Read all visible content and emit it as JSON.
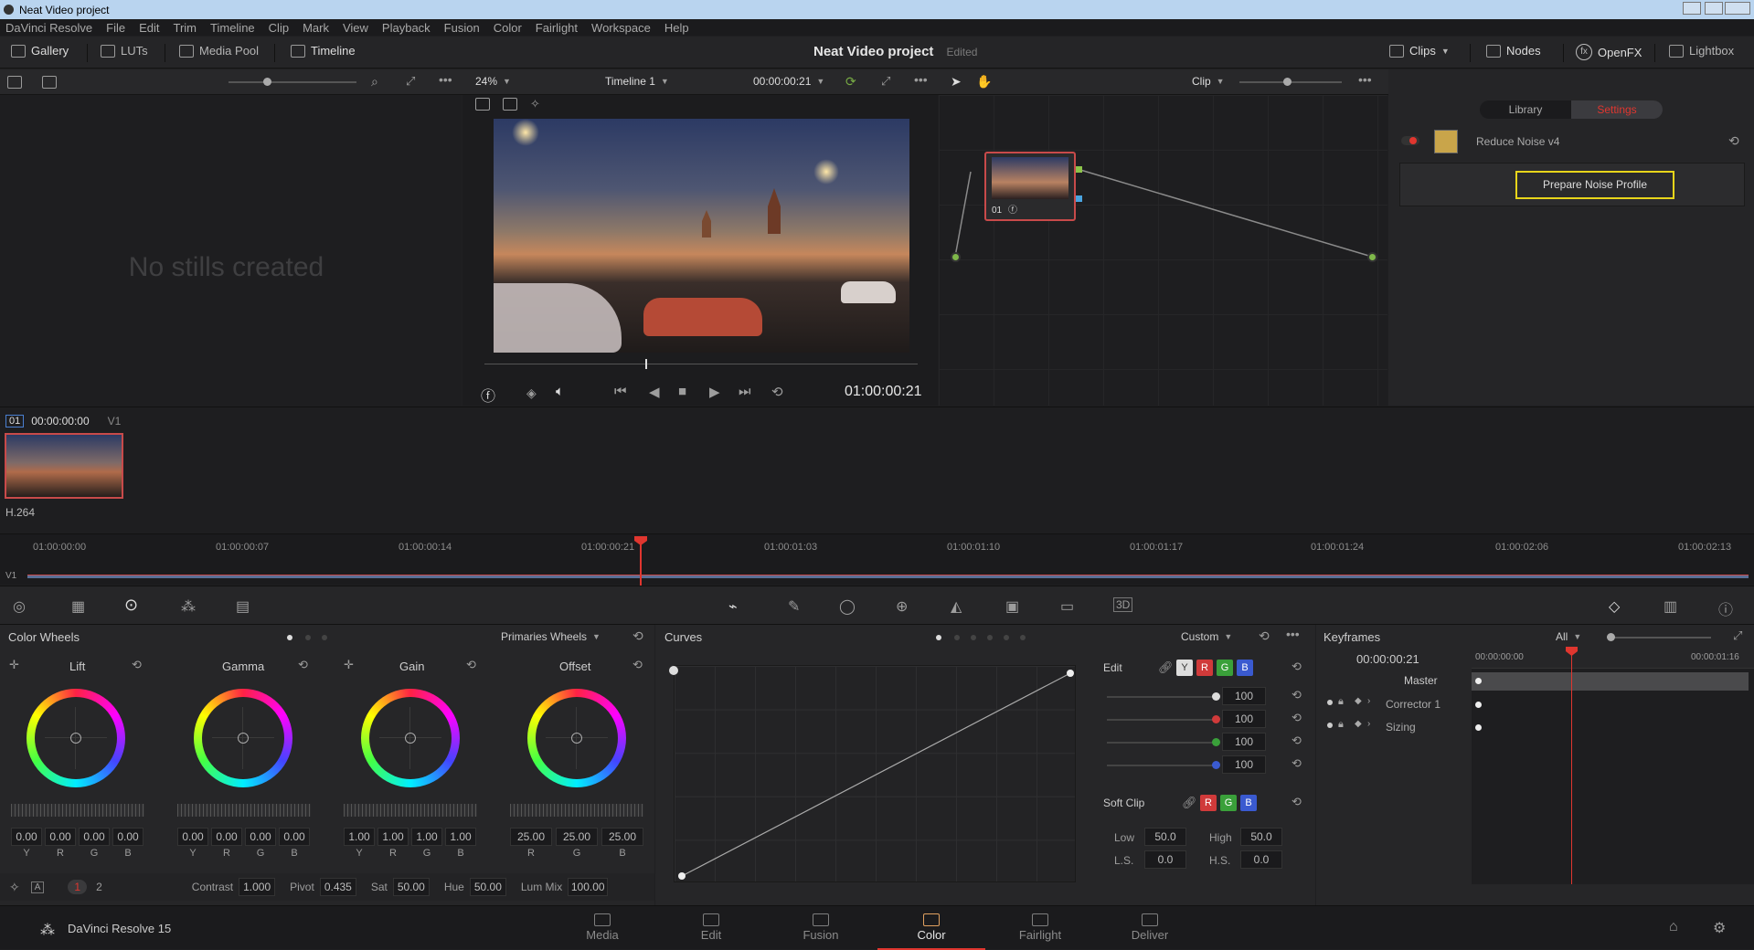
{
  "window": {
    "title": "Neat Video project"
  },
  "menu": [
    "DaVinci Resolve",
    "File",
    "Edit",
    "Trim",
    "Timeline",
    "Clip",
    "Mark",
    "View",
    "Playback",
    "Fusion",
    "Color",
    "Fairlight",
    "Workspace",
    "Help"
  ],
  "toolbar": {
    "gallery": "Gallery",
    "luts": "LUTs",
    "media_pool": "Media Pool",
    "timeline": "Timeline",
    "project_name": "Neat Video project",
    "project_status": "Edited",
    "clips": "Clips",
    "nodes": "Nodes",
    "openfx": "OpenFX",
    "lightbox": "Lightbox"
  },
  "viewer": {
    "zoom": "24%",
    "timeline_name": "Timeline 1",
    "timecode_top": "00:00:00:21",
    "timecode": "01:00:00:21"
  },
  "gallery": {
    "empty_text": "No stills created"
  },
  "nodes_panel": {
    "mode": "Clip",
    "node_label": "01"
  },
  "fx": {
    "tabs": [
      "Library",
      "Settings"
    ],
    "active_tab": "Settings",
    "effect_name": "Reduce Noise v4",
    "prepare_button": "Prepare Noise Profile"
  },
  "clip": {
    "index": "01",
    "timecode": "00:00:00:00",
    "track": "V1",
    "codec": "H.264"
  },
  "timeline": {
    "track": "V1",
    "ticks": [
      "01:00:00:00",
      "01:00:00:07",
      "01:00:00:14",
      "01:00:00:21",
      "01:00:01:03",
      "01:00:01:10",
      "01:00:01:17",
      "01:00:01:24",
      "01:00:02:06",
      "01:00:02:13"
    ]
  },
  "color_wheels": {
    "title": "Color Wheels",
    "mode": "Primaries Wheels",
    "wheels": [
      {
        "name": "Lift",
        "values": [
          "0.00",
          "0.00",
          "0.00",
          "0.00"
        ],
        "channels": [
          "Y",
          "R",
          "G",
          "B"
        ]
      },
      {
        "name": "Gamma",
        "values": [
          "0.00",
          "0.00",
          "0.00",
          "0.00"
        ],
        "channels": [
          "Y",
          "R",
          "G",
          "B"
        ]
      },
      {
        "name": "Gain",
        "values": [
          "1.00",
          "1.00",
          "1.00",
          "1.00"
        ],
        "channels": [
          "Y",
          "R",
          "G",
          "B"
        ]
      },
      {
        "name": "Offset",
        "values": [
          "25.00",
          "25.00",
          "25.00"
        ],
        "channels": [
          "R",
          "G",
          "B"
        ]
      }
    ],
    "pages": [
      "1",
      "2"
    ],
    "contrast_label": "Contrast",
    "contrast": "1.000",
    "pivot_label": "Pivot",
    "pivot": "0.435",
    "sat_label": "Sat",
    "sat": "50.00",
    "hue_label": "Hue",
    "hue": "50.00",
    "lummix_label": "Lum Mix",
    "lummix": "100.00"
  },
  "curves": {
    "title": "Curves",
    "mode": "Custom",
    "edit_label": "Edit",
    "channel_buttons": [
      "Y",
      "R",
      "G",
      "B"
    ],
    "edit_values": [
      "100",
      "100",
      "100",
      "100"
    ],
    "soft_clip_label": "Soft Clip",
    "low_label": "Low",
    "low": "50.0",
    "high_label": "High",
    "high": "50.0",
    "ls_label": "L.S.",
    "ls": "0.0",
    "hs_label": "H.S.",
    "hs": "0.0"
  },
  "keyframes": {
    "title": "Keyframes",
    "filter": "All",
    "timecode": "00:00:00:21",
    "ruler": [
      "00:00:00:00",
      "00:00:01:16"
    ],
    "rows": [
      "Master",
      "Corrector 1",
      "Sizing"
    ]
  },
  "pages": [
    "Media",
    "Edit",
    "Fusion",
    "Color",
    "Fairlight",
    "Deliver"
  ],
  "active_page": "Color",
  "app_name": "DaVinci Resolve 15",
  "colors": {
    "accent_red": "#e0362f",
    "highlight_yellow": "#e8d51a",
    "active_tab": "#3b3b3f"
  }
}
